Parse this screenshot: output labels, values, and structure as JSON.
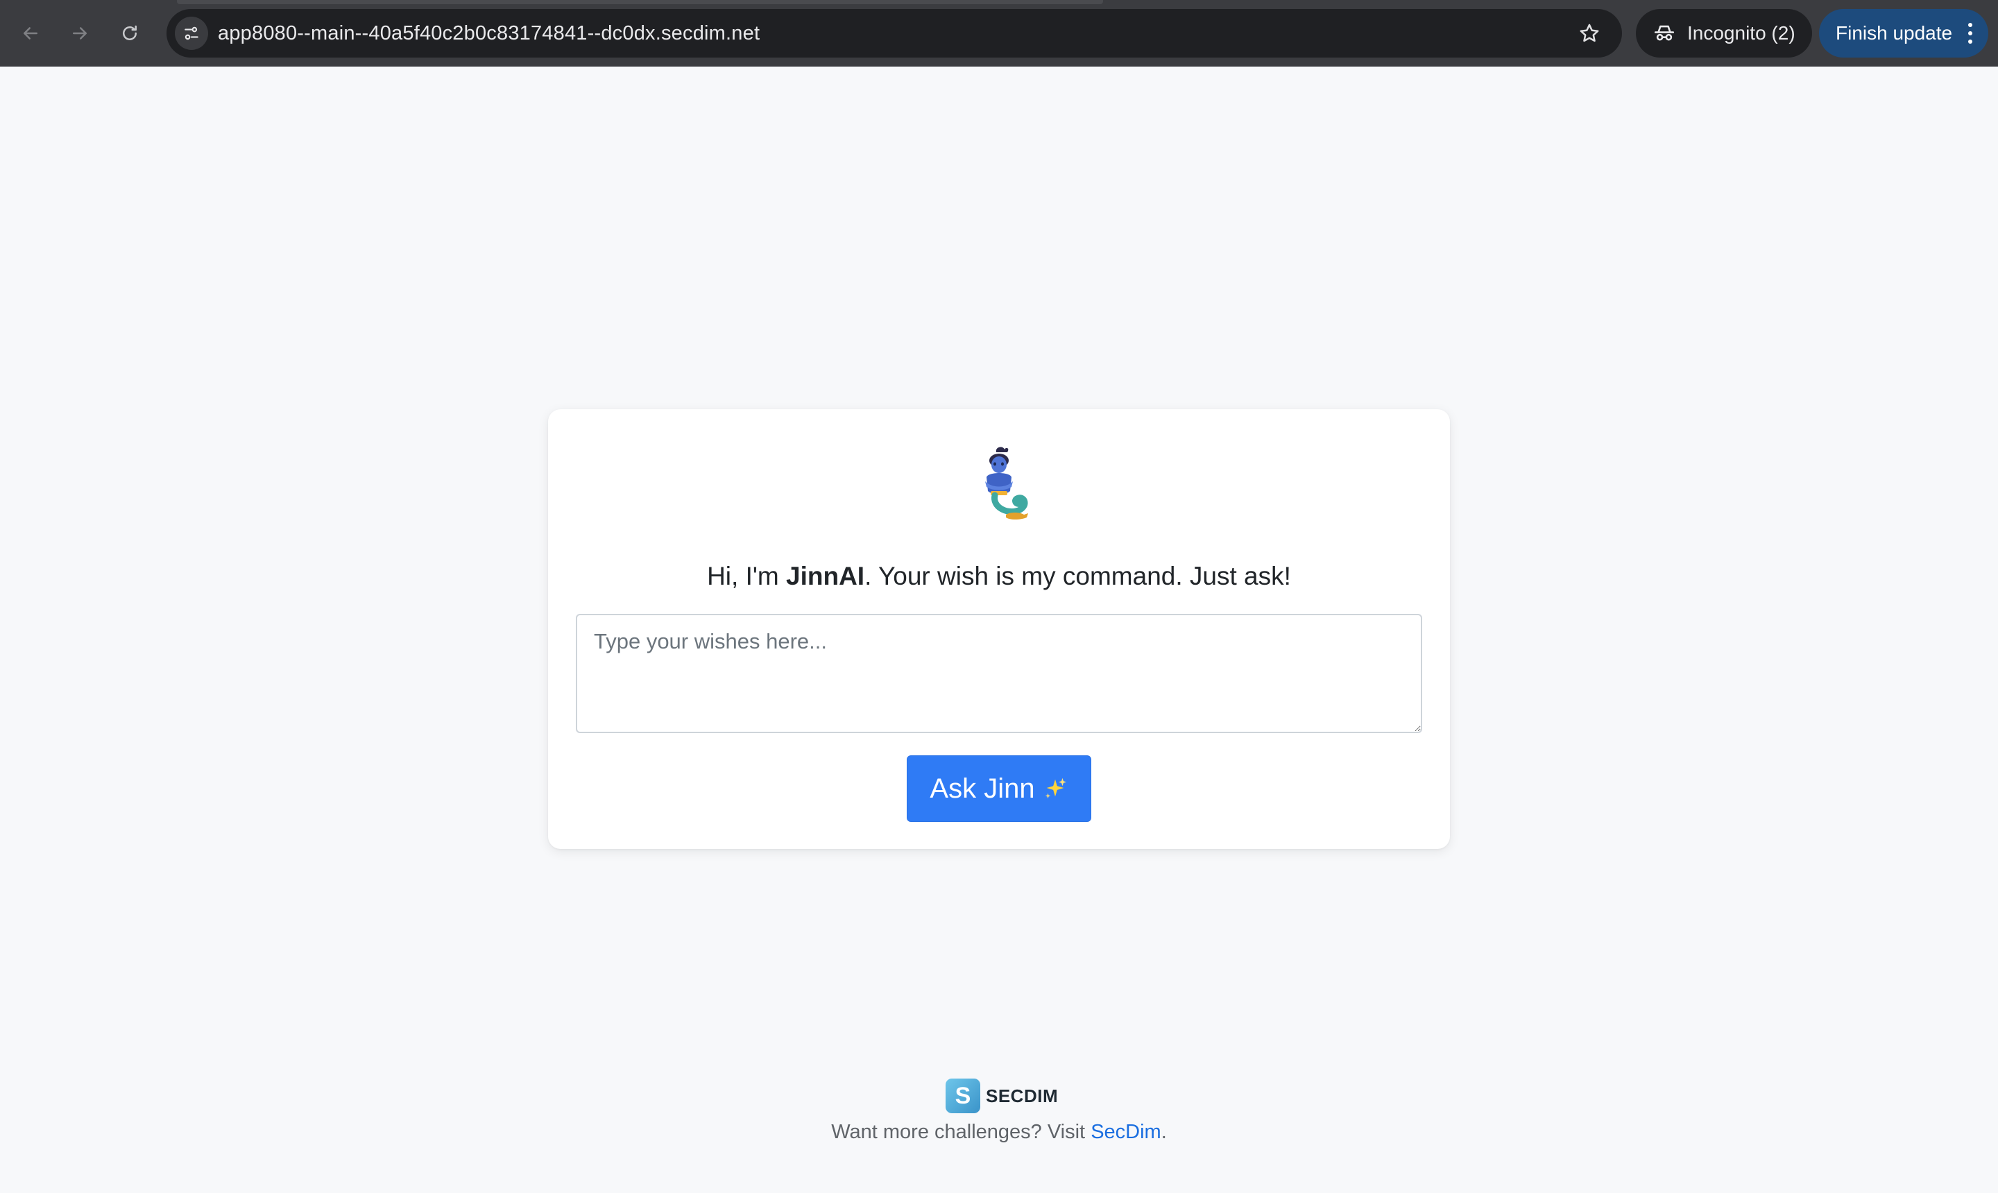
{
  "browser": {
    "url": "app8080--main--40a5f40c2b0c83174841--dc0dx.secdim.net",
    "incognito_label": "Incognito (2)",
    "update_label": "Finish update",
    "icons": [
      "back-arrow-icon",
      "forward-arrow-icon",
      "reload-icon",
      "site-settings-icon",
      "bookmark-star-icon",
      "incognito-icon",
      "more-vert-icon"
    ]
  },
  "card": {
    "greeting_prefix": "Hi, I'm ",
    "greeting_name": "JinnAI",
    "greeting_suffix": ". Your wish is my command. Just ask!",
    "input_placeholder": "Type your wishes here...",
    "input_value": "",
    "button_label": "Ask Jinn",
    "icons": [
      "genie-icon",
      "sparkles-icon"
    ]
  },
  "footer": {
    "logo_letter": "S",
    "logo_word": "SECDIM",
    "text_prefix": "Want more challenges? Visit ",
    "link_text": "SecDim",
    "text_suffix": "."
  },
  "colors": {
    "page_bg": "#f7f8fa",
    "primary_button": "#2f7bf5",
    "link": "#1a6ee0",
    "chrome_bg": "#3b3c40",
    "update_button": "#1d4b7d"
  }
}
